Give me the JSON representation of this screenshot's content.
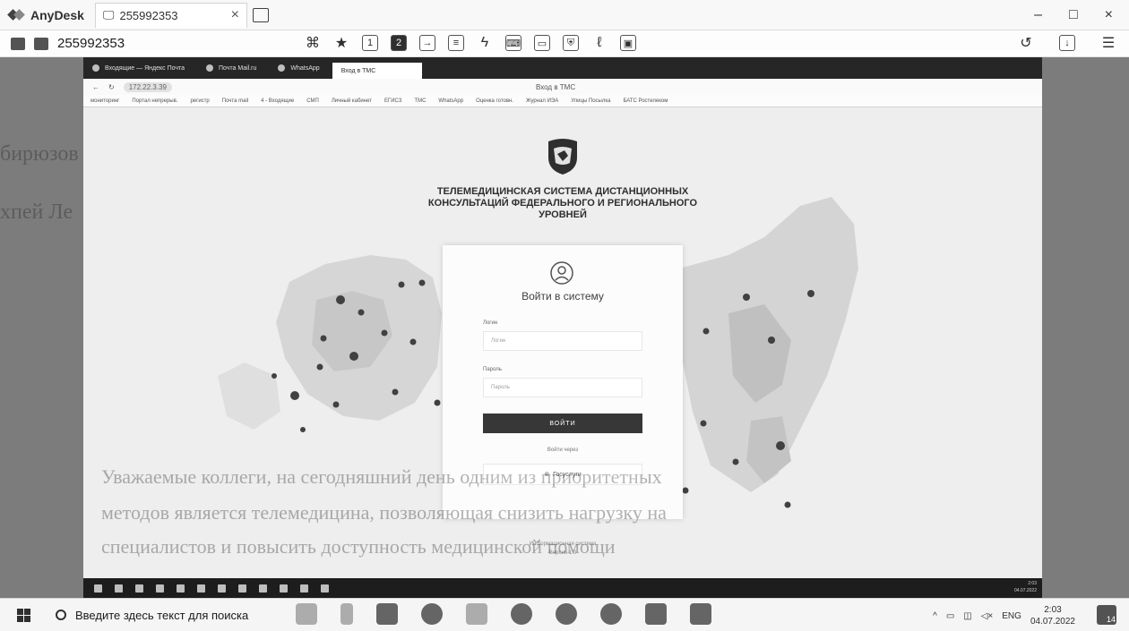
{
  "anydesk": {
    "app_name": "AnyDesk",
    "tab_label": "255992353",
    "tab_close": "×",
    "address": "255992353",
    "win_min": "–",
    "win_max": "□",
    "win_close": "×"
  },
  "browser": {
    "tabs": [
      "Входящие — Яндекс Почта",
      "Почта Mail.ru",
      "WhatsApp",
      "Вход в ТМС"
    ],
    "active_tab_label": "Вход в ТМС",
    "url": "172.22.3.39",
    "page_title": "Вход в ТМС",
    "bookmarks": [
      "мониторинг",
      "Портал непрерыв.",
      "регистр",
      "Почта mail",
      "4 - Входящие",
      "СМП",
      "Личный кабинет",
      "ЕГИСЗ",
      "ТМС",
      "WhatsApp",
      "Оценка готовн.",
      "Журнал ИЭА",
      "Улицы Посылка",
      "БАТС Ростелеком"
    ]
  },
  "login_page": {
    "system_title_lines": [
      "ТЕЛЕМЕДИЦИНСКАЯ СИСТЕМА ДИСТАНЦИОННЫХ",
      "КОНСУЛЬТАЦИЙ ФЕДЕРАЛЬНОГО И РЕГИОНАЛЬНОГО",
      "УРОВНЕЙ"
    ],
    "form_title": "Войти в систему",
    "login_label": "Логин",
    "login_placeholder": "Логин",
    "password_label": "Пароль",
    "password_placeholder": "Пароль",
    "submit_label": "ВОЙТИ",
    "alt_link": "Войти через",
    "gosuslugi_label": "Госуслуги",
    "footer_line1": "Информационная система",
    "footer_line2": "Версия 1.0"
  },
  "remote_clock": {
    "time": "2:03",
    "date": "04.07.2022"
  },
  "windows": {
    "search_placeholder": "Введите здесь текст для поиска",
    "lang": "ENG",
    "time": "2:03",
    "date": "04.07.2022",
    "notif_count": "14"
  },
  "background_text": [
    "бирюзов О.П.",
    "хпей Ле",
    "Уважаемые коллеги, на сегодняшний день одним из приоритетных",
    "методов является телемедицина, позволяющая снизить нагрузку на",
    "специалистов и повысить доступность медицинской помощи"
  ]
}
